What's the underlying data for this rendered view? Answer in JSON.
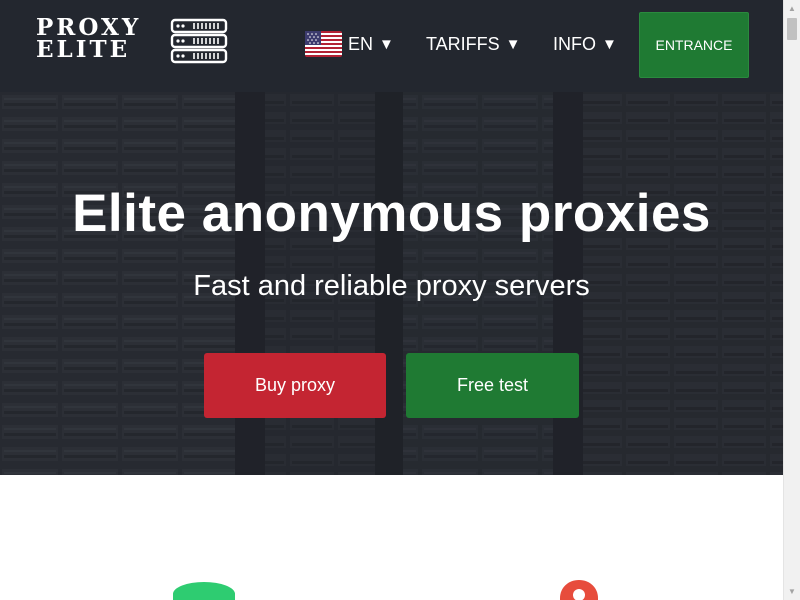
{
  "header": {
    "logo_line1": "PROXY",
    "logo_line2": "ELITE",
    "language": {
      "label": "EN",
      "arrow": "▼",
      "flag_icon": "us-flag-icon"
    },
    "nav": [
      {
        "label": "TARIFFS",
        "arrow": "▼"
      },
      {
        "label": "INFO",
        "arrow": "▼"
      }
    ],
    "entrance_label": "ENTRANCE"
  },
  "hero": {
    "title": "Elite anonymous proxies",
    "subtitle": "Fast and reliable proxy servers",
    "buy_label": "Buy proxy",
    "test_label": "Free test"
  },
  "features": {
    "icons": [
      "database-icon",
      "map-pin-icon"
    ]
  },
  "colors": {
    "header_bg": "#23272f",
    "green": "#1f7a33",
    "red": "#c42532",
    "icon_green": "#2ecc71",
    "icon_red": "#e74c3c"
  },
  "scrollbar": {
    "up": "▲",
    "down": "▼"
  }
}
